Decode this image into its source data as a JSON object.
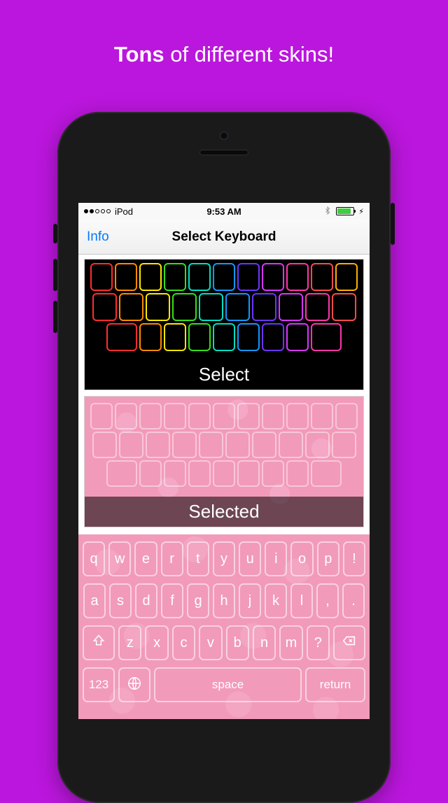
{
  "headline": {
    "bold": "Tons",
    "rest": " of different skins!"
  },
  "statusbar": {
    "carrier": "iPod",
    "time": "9:53 AM",
    "bluetooth_icon": "bluetooth-icon",
    "battery_icon": "battery-icon",
    "charging_icon": "bolt-icon"
  },
  "navbar": {
    "left_button": "Info",
    "title": "Select Keyboard"
  },
  "skins": [
    {
      "name": "rainbow-neon",
      "action_label": "Select",
      "selected": false
    },
    {
      "name": "pink-flowers",
      "action_label": "Selected",
      "selected": true
    }
  ],
  "keyboard": {
    "skin": "pink-flowers",
    "rows": [
      [
        "q",
        "w",
        "e",
        "r",
        "t",
        "y",
        "u",
        "i",
        "o",
        "p",
        "!"
      ],
      [
        "a",
        "s",
        "d",
        "f",
        "g",
        "h",
        "j",
        "k",
        "l",
        ",",
        "."
      ],
      [
        "⇧",
        "z",
        "x",
        "c",
        "v",
        "b",
        "n",
        "m",
        "?",
        "⌫"
      ]
    ],
    "bottom": {
      "numbers_label": "123",
      "globe_icon": "globe-icon",
      "space_label": "space",
      "return_label": "return"
    }
  },
  "colors": {
    "page_bg": "#bb16dd",
    "ios_blue": "#007aff",
    "pink_skin": "#f29ab9",
    "battery_green": "#3fce3f",
    "rainbow": [
      "#ff2d2d",
      "#ff8a00",
      "#ffe600",
      "#35e01b",
      "#00e0c3",
      "#1398ff",
      "#6a36ff",
      "#d836ff",
      "#ff36a8",
      "#ff4a4a",
      "#ffae00"
    ]
  }
}
